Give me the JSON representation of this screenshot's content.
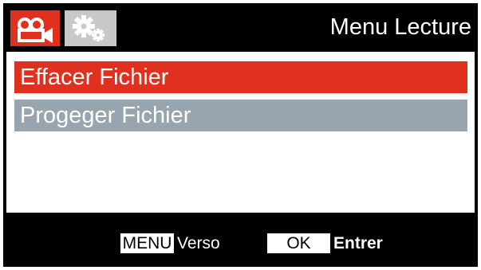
{
  "header": {
    "title": "Menu Lecture",
    "tabs": [
      {
        "icon": "video-camera-icon",
        "active": true
      },
      {
        "icon": "gears-icon",
        "active": false
      }
    ]
  },
  "menu": {
    "items": [
      {
        "label": "Effacer Fichier",
        "selected": true
      },
      {
        "label": "Progeger Fichier",
        "selected": false
      }
    ]
  },
  "footer": {
    "menu_key": "MENU",
    "menu_action": "Verso",
    "ok_key": "OK",
    "ok_action": "Entrer"
  },
  "colors": {
    "accent_red": "#e0301e",
    "item_grey": "#98a5ae",
    "tab_inactive": "#c8c8c8",
    "background_black": "#000000"
  }
}
